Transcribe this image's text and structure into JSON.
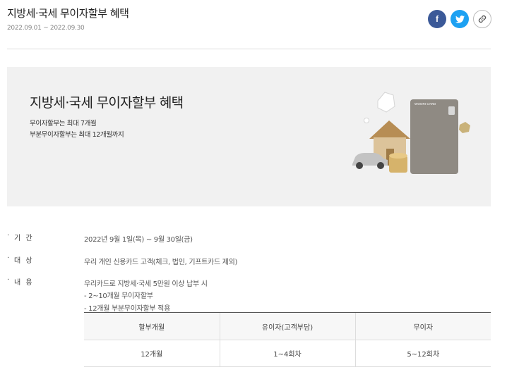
{
  "header": {
    "title": "지방세·국세 무이자할부 혜택",
    "period": "2022.09.01 ~ 2022.09.30"
  },
  "share": {
    "facebook": "f",
    "icons": [
      "facebook-icon",
      "twitter-icon",
      "link-icon"
    ],
    "colors": {
      "facebook": "#3b5998",
      "twitter": "#1da1f2"
    }
  },
  "banner": {
    "title": "지방세·국세 무이자할부 혜택",
    "line1": "무이자할부는 최대 7개월",
    "line2": "부분무이자할부는 최대 12개월까지",
    "card_brand": "WOORI CARD"
  },
  "details": {
    "bullet": "·",
    "period_label": "기 간",
    "period_value": "2022년 9월 1일(목) ~ 9월 30일(금)",
    "target_label": "대 상",
    "target_value": "우리 개인 신용카드 고객(체크, 법인, 기프트카드 제외)",
    "content_label": "내 용",
    "content_line1": "우리카드로 지방세·국세 5만원 이상 납부 시",
    "content_line2": "- 2~10개월 무이자할부",
    "content_line3": "- 12개월 부분무이자할부 적용"
  },
  "table": {
    "headers": [
      "할부개월",
      "유이자(고객부담)",
      "무이자"
    ],
    "rows": [
      [
        "12개월",
        "1~4회차",
        "5~12회차"
      ]
    ]
  }
}
